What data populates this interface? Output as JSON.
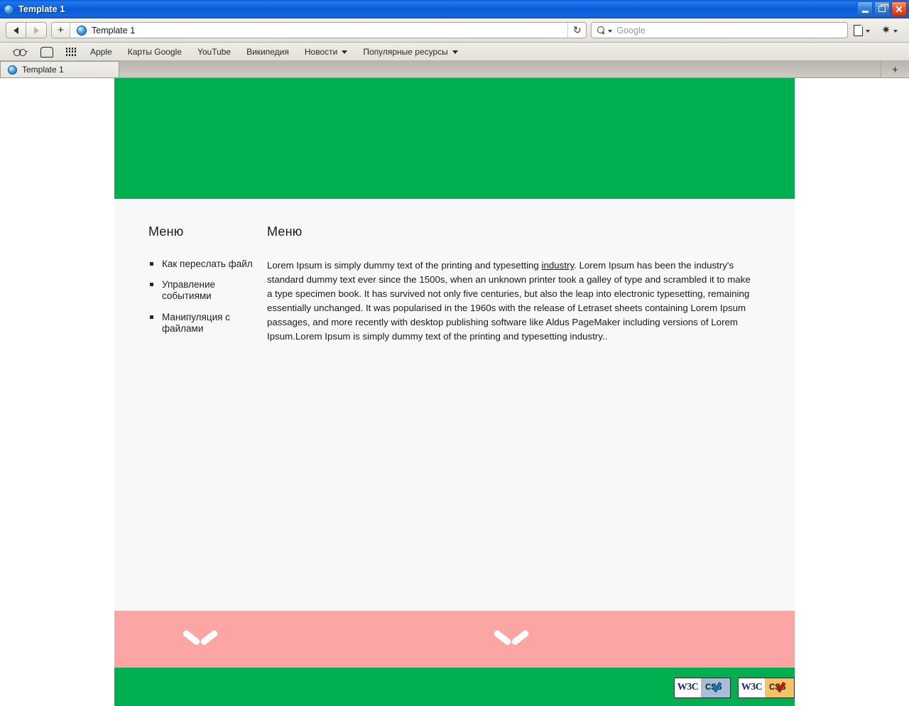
{
  "window": {
    "title": "Template 1",
    "icon": "globe-icon",
    "controls": {
      "minimize": "minimize-button",
      "maximize": "maximize-button",
      "close": "close-button"
    }
  },
  "toolbar": {
    "back_label": "back-arrow",
    "forward_label": "forward-arrow",
    "new_tab_label": "+",
    "address_value": "Template 1",
    "reload_label": "↻",
    "search_placeholder": "Google",
    "search_value": "",
    "page_actions_icon": "page-icon",
    "settings_icon": "gear-icon"
  },
  "bookmarks": {
    "icons": [
      {
        "name": "reader-glasses-icon"
      },
      {
        "name": "bookmarks-book-icon"
      },
      {
        "name": "top-sites-grid-icon"
      }
    ],
    "items": [
      {
        "label": "Apple",
        "dropdown": false
      },
      {
        "label": "Карты Google",
        "dropdown": false
      },
      {
        "label": "YouTube",
        "dropdown": false
      },
      {
        "label": "Википедия",
        "dropdown": false
      },
      {
        "label": "Новости",
        "dropdown": true
      },
      {
        "label": "Популярные ресурсы",
        "dropdown": true
      }
    ]
  },
  "tabs": {
    "items": [
      {
        "title": "Template 1",
        "active": true
      }
    ],
    "new_tab_label": "+"
  },
  "page": {
    "sidebar": {
      "heading": "Меню",
      "items": [
        "Как переслать файл",
        "Управление событиями",
        "Манипуляция с файлами"
      ]
    },
    "content": {
      "heading": "Меню",
      "paragraph_before_link": "Lorem Ipsum is simply dummy text of the printing and typesetting ",
      "link_text": "industry",
      "paragraph_after_link": ". Lorem Ipsum has been the industry's standard dummy text ever since the 1500s, when an unknown printer took a galley of type and scrambled it to make a type specimen book. It has survived not only five centuries, but also the leap into electronic typesetting, remaining essentially unchanged. It was popularised in the 1960s with the release of Letraset sheets containing Lorem Ipsum passages, and more recently with desktop publishing software like Aldus PageMaker including versions of Lorem Ipsum.Lorem Ipsum is simply dummy text of the printing and typesetting industry.."
    },
    "chevrons": [
      "chevron-down-icon",
      "chevron-down-icon"
    ],
    "badges": [
      {
        "mark": "W3C",
        "label": "CSS",
        "style": "blue"
      },
      {
        "mark": "W3C",
        "label": "CSS",
        "style": "gold"
      }
    ],
    "colors": {
      "hero_green": "#00b050",
      "pink_band": "#fca5a5",
      "content_bg": "#f8f8f8"
    }
  }
}
